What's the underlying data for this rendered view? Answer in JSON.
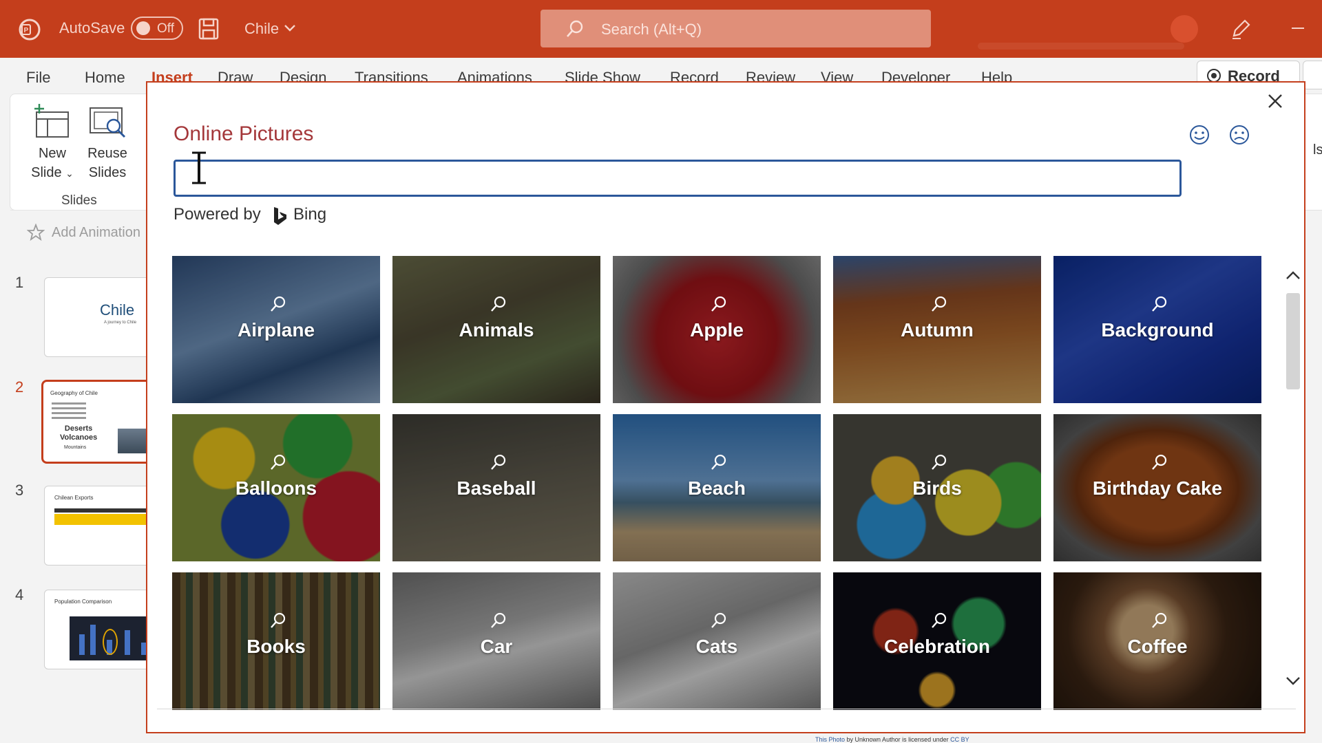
{
  "titlebar": {
    "autosave_label": "AutoSave",
    "toggle_state": "Off",
    "document_name": "Chile",
    "search_placeholder": "Search (Alt+Q)"
  },
  "tabs": [
    "File",
    "Home",
    "Insert",
    "Draw",
    "Design",
    "Transitions",
    "Animations",
    "Slide Show",
    "Record",
    "Review",
    "View",
    "Developer",
    "Help"
  ],
  "active_tab": "Insert",
  "record_button": "Record",
  "ribbon": {
    "new_slide_line1": "New",
    "new_slide_line2": "Slide",
    "reuse_line1": "Reuse",
    "reuse_line2": "Slides",
    "group_label": "Slides",
    "add_animation": "Add Animation",
    "tools_partial": "ls"
  },
  "slides": [
    {
      "number": "1",
      "title": "Chile",
      "subtitle": "A journey to Chile"
    },
    {
      "number": "2",
      "title": "Geography of Chile",
      "big_text": "Deserts\nVolcanoes",
      "small_text": "Mountains"
    },
    {
      "number": "3",
      "title": "Chilean Exports"
    },
    {
      "number": "4",
      "title": "Population Comparison"
    }
  ],
  "dialog": {
    "title": "Online Pictures",
    "search_value": "",
    "powered_by": "Powered by",
    "bing_label": "Bing",
    "tiles": [
      {
        "label": "Airplane"
      },
      {
        "label": "Animals"
      },
      {
        "label": "Apple"
      },
      {
        "label": "Autumn"
      },
      {
        "label": "Background"
      },
      {
        "label": "Balloons"
      },
      {
        "label": "Baseball"
      },
      {
        "label": "Beach"
      },
      {
        "label": "Birds"
      },
      {
        "label": "Birthday Cake"
      },
      {
        "label": "Books"
      },
      {
        "label": "Car"
      },
      {
        "label": "Cats"
      },
      {
        "label": "Celebration"
      },
      {
        "label": "Coffee"
      }
    ]
  },
  "attribution": {
    "link_text": "This Photo",
    "middle_text": " by Unknown Author is licensed under ",
    "license": "CC BY"
  }
}
